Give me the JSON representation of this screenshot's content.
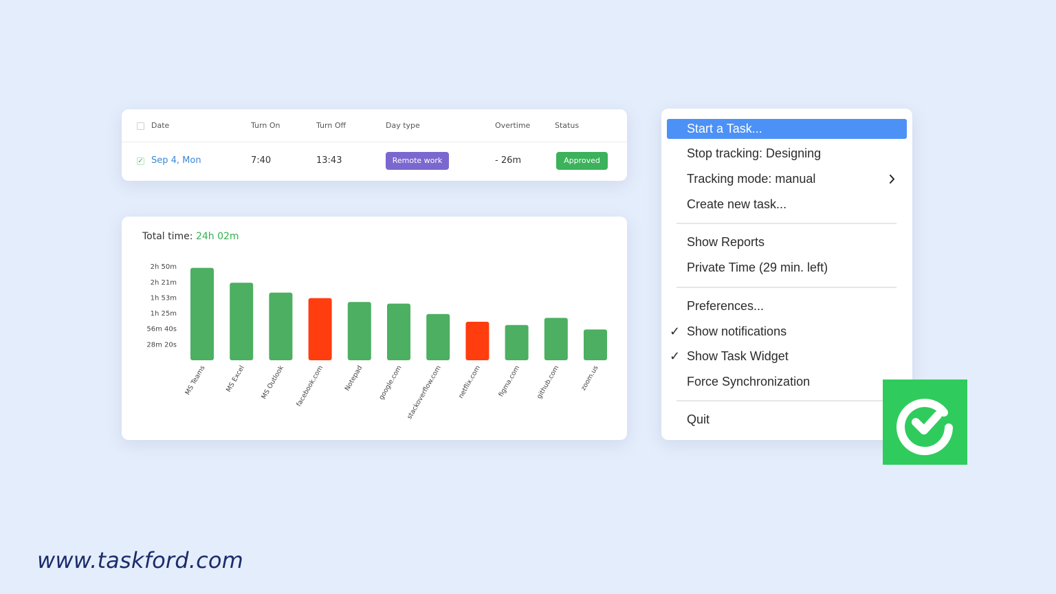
{
  "table": {
    "headers": [
      "Date",
      "Turn On",
      "Turn Off",
      "Day type",
      "Overtime",
      "Status"
    ],
    "row": {
      "date": "Sep 4, Mon",
      "turn_on": "7:40",
      "turn_off": "13:43",
      "day_type": "Remote work",
      "overtime": "- 26m",
      "status": "Approved"
    },
    "colors": {
      "day_type": "#7b68cf",
      "status": "#3bb25b",
      "date_link": "#3b87d6"
    }
  },
  "chart": {
    "label": "Total time:",
    "total": "24h 02m"
  },
  "chart_data": {
    "type": "bar",
    "title": "Total time: 24h 02m",
    "xlabel": "",
    "ylabel": "",
    "y_tick_labels": [
      "2h 50m",
      "2h 21m",
      "1h 53m",
      "1h 25m",
      "56m 40s",
      "28m 20s"
    ],
    "y_tick_minutes": [
      170,
      141,
      113,
      85,
      56.67,
      28.33
    ],
    "categories": [
      "MS Teams",
      "MS Excel",
      "MS Outlook",
      "facebook.com",
      "Notepad",
      "google.com",
      "stackoverflow.com",
      "netflix.com",
      "figma.com",
      "github.com",
      "zoom.us"
    ],
    "values_minutes": [
      168,
      141,
      123,
      113,
      106,
      103,
      84,
      70,
      64,
      77,
      56
    ],
    "bar_colors": [
      "#4caf62",
      "#4caf62",
      "#4caf62",
      "#ff3d0e",
      "#4caf62",
      "#4caf62",
      "#4caf62",
      "#ff3d0e",
      "#4caf62",
      "#4caf62",
      "#4caf62"
    ],
    "grid": false,
    "legend": "none"
  },
  "menu": {
    "items": [
      {
        "label": "Start a Task...",
        "active": true,
        "checked": false,
        "submenu": false
      },
      {
        "label": "Stop tracking: Designing",
        "active": false,
        "checked": false,
        "submenu": false
      },
      {
        "label": "Tracking mode: manual",
        "active": false,
        "checked": false,
        "submenu": true
      },
      {
        "label": "Create new task...",
        "active": false,
        "checked": false,
        "submenu": false
      },
      {
        "label": "Show Reports",
        "active": false,
        "checked": false,
        "submenu": false
      },
      {
        "label": "Private Time (29 min. left)",
        "active": false,
        "checked": false,
        "submenu": false
      },
      {
        "label": "Preferences...",
        "active": false,
        "checked": false,
        "submenu": false
      },
      {
        "label": "Show notifications",
        "active": false,
        "checked": true,
        "submenu": false
      },
      {
        "label": "Show Task Widget",
        "active": false,
        "checked": true,
        "submenu": false
      },
      {
        "label": "Force Synchronization",
        "active": false,
        "checked": false,
        "submenu": false
      },
      {
        "label": "Quit",
        "active": false,
        "checked": false,
        "submenu": false
      }
    ],
    "check_glyph": "✓",
    "highlight_color": "#4c91f5"
  },
  "logo": {
    "icon": "check-circle-icon",
    "color": "#2fcc5d"
  },
  "footer": {
    "url": "www.taskford.com"
  }
}
